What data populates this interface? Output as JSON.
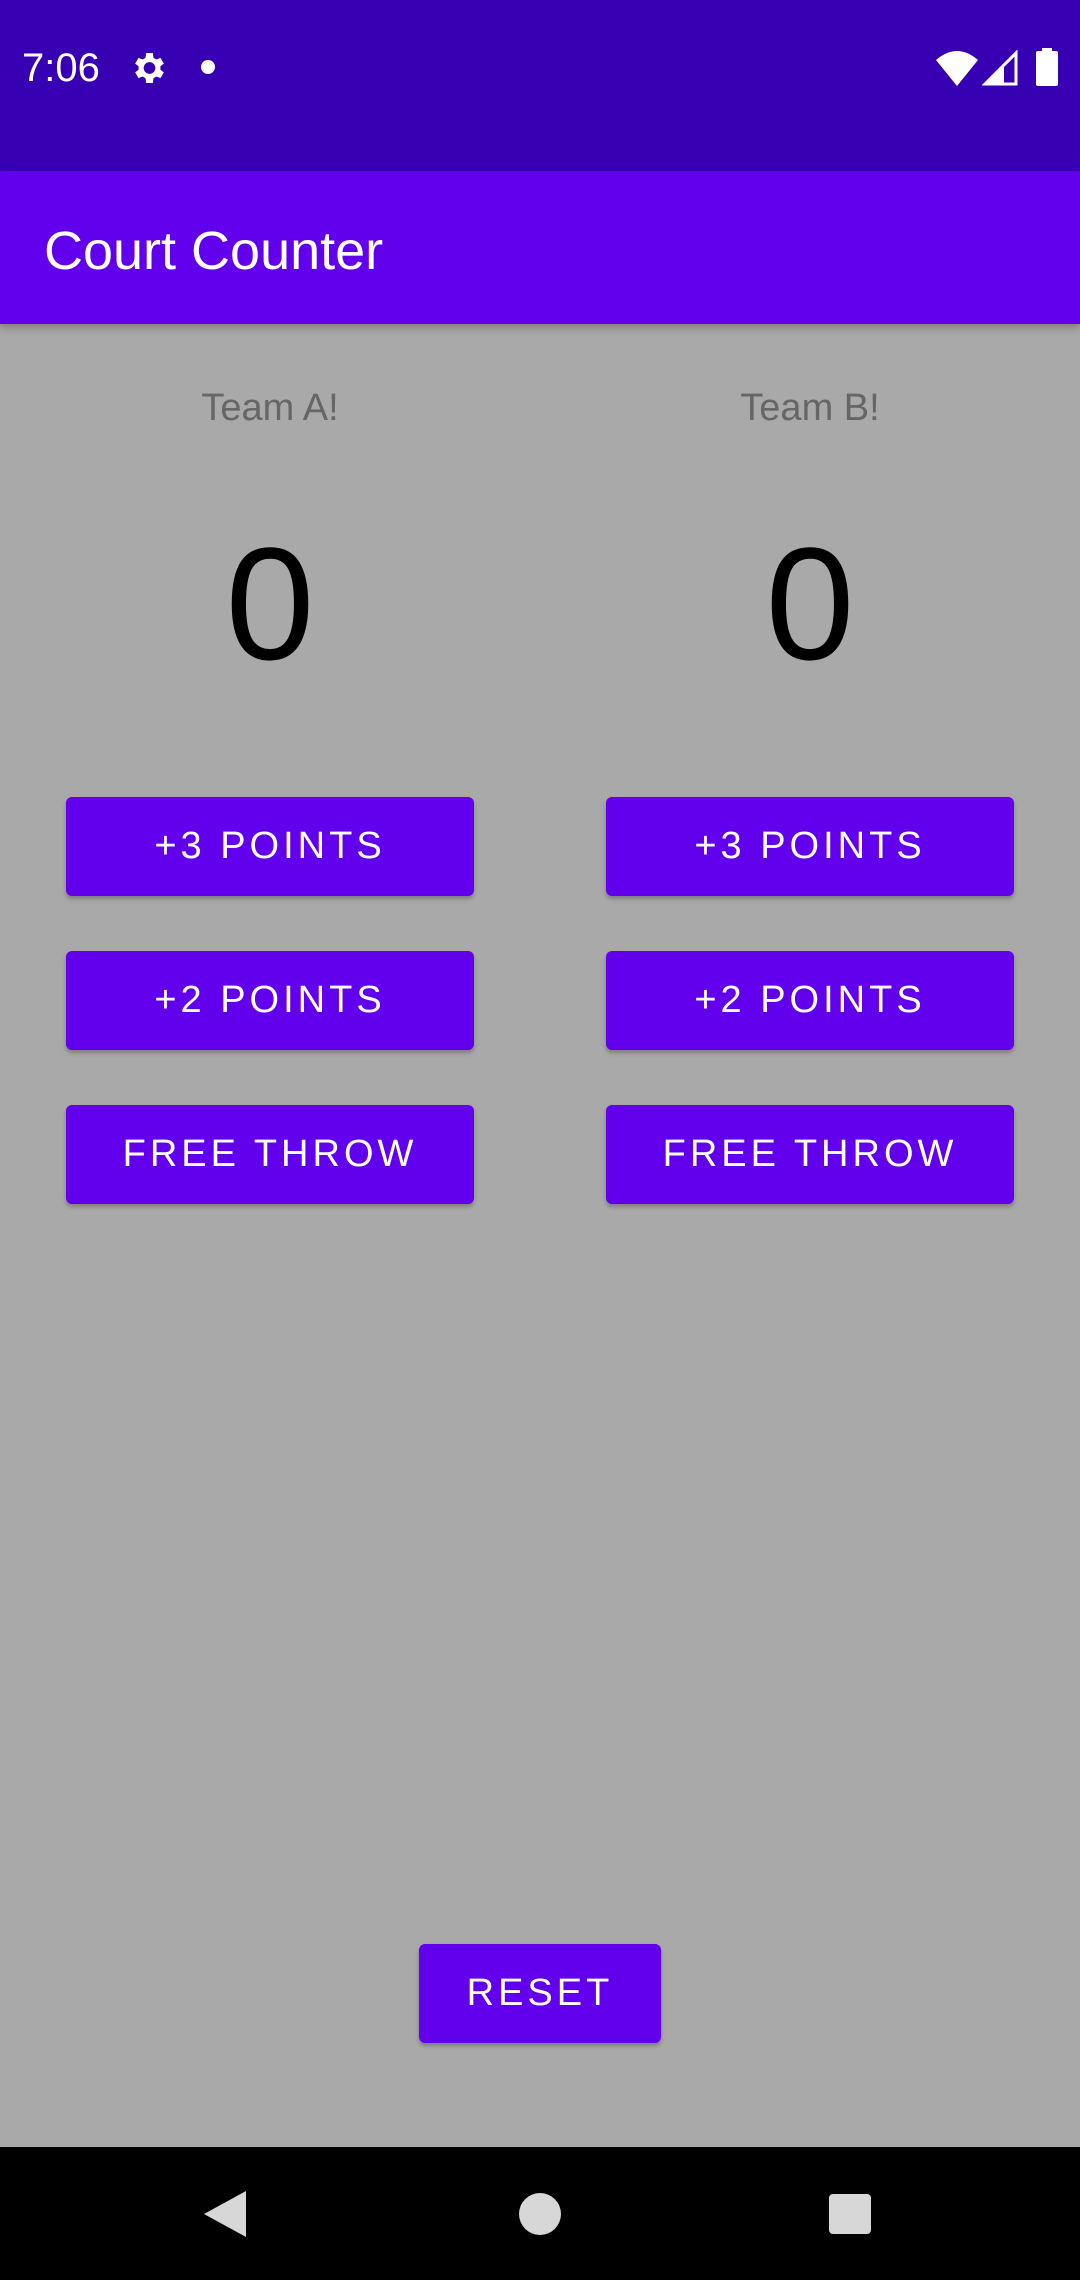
{
  "status_bar": {
    "time": "7:06",
    "icons": [
      "gear-icon",
      "notification-dot-icon",
      "wifi-icon",
      "signal-icon",
      "battery-icon"
    ],
    "background": "#3700b3"
  },
  "app_bar": {
    "title": "Court Counter",
    "background": "#6200ee"
  },
  "team_a": {
    "name": "Team A!",
    "score": "0",
    "buttons": {
      "three": "+3 POINTS",
      "two": "+2 POINTS",
      "free": "FREE THROW"
    }
  },
  "team_b": {
    "name": "Team B!",
    "score": "0",
    "buttons": {
      "three": "+3 POINTS",
      "two": "+2 POINTS",
      "free": "FREE THROW"
    }
  },
  "reset_label": "RESET",
  "colors": {
    "accent": "#6200ee",
    "background": "#a9a9a9"
  },
  "nav_bar": {
    "icons": [
      "back-icon",
      "home-icon",
      "recents-icon"
    ]
  }
}
